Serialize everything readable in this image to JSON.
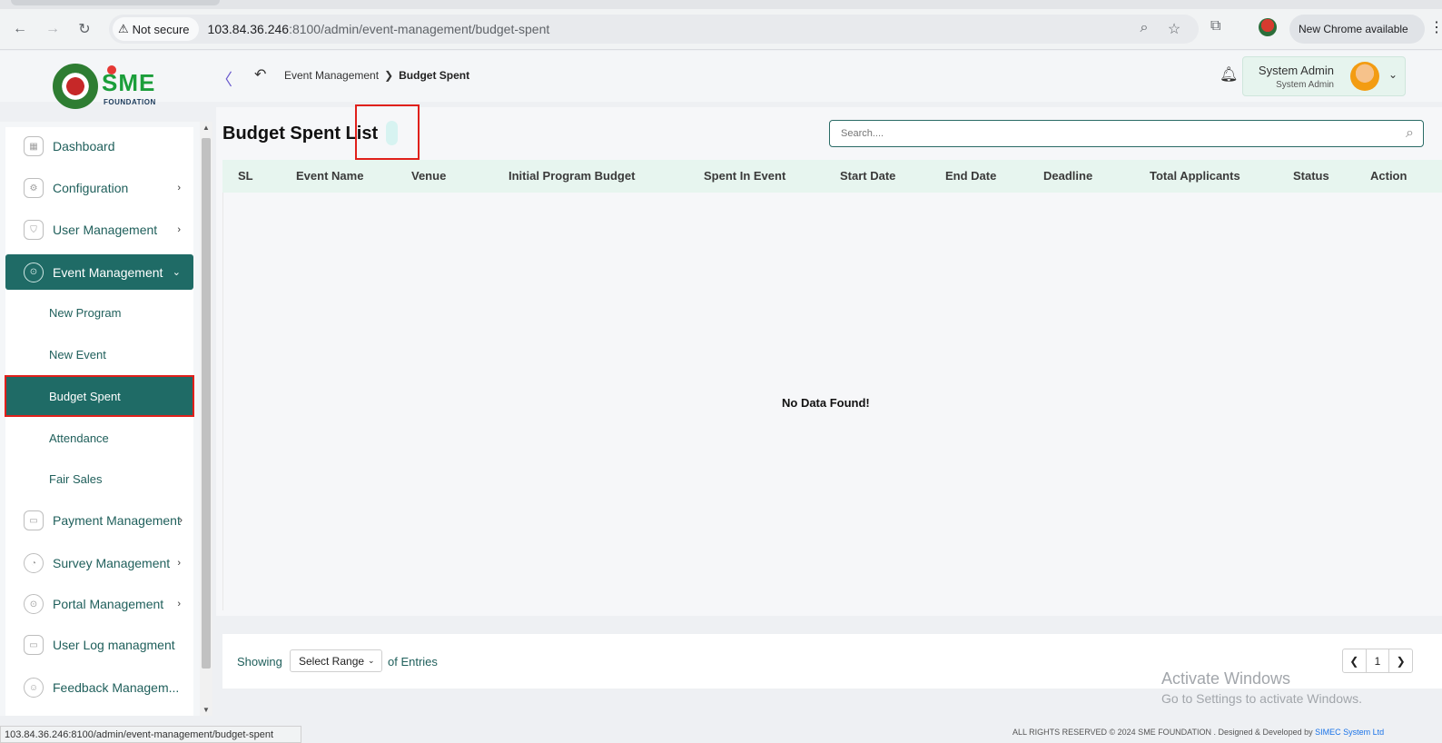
{
  "browser": {
    "security_label": "Not secure",
    "url_host": "103.84.36.246",
    "url_rest": ":8100/admin/event-management/budget-spent",
    "new_chrome_label": "New Chrome available"
  },
  "header": {
    "logo_text": "SME",
    "logo_subtext": "FOUNDATION",
    "breadcrumb_parent": "Event Management",
    "breadcrumb_separator": "❯",
    "breadcrumb_current": "Budget Spent",
    "user_name": "System Admin",
    "user_role": "System Admin"
  },
  "sidebar": {
    "items": [
      {
        "label": "Dashboard",
        "icon": "grid-icon"
      },
      {
        "label": "Configuration",
        "icon": "config-icon"
      },
      {
        "label": "User Management",
        "icon": "shield-user-icon"
      },
      {
        "label": "Event Management",
        "icon": "lock-icon"
      },
      {
        "label": "Payment Management",
        "icon": "money-icon"
      },
      {
        "label": "Survey Management",
        "icon": "pie-icon"
      },
      {
        "label": "Portal Management",
        "icon": "lock-icon"
      },
      {
        "label": "User Log managment",
        "icon": "money-icon"
      },
      {
        "label": "Feedback Managem...",
        "icon": "feedback-icon"
      }
    ],
    "subitems": [
      {
        "label": "New Program"
      },
      {
        "label": "New Event"
      },
      {
        "label": "Budget Spent"
      },
      {
        "label": "Attendance"
      },
      {
        "label": "Fair Sales"
      }
    ]
  },
  "main": {
    "title": "Budget Spent List",
    "search_placeholder": "Search....",
    "columns": [
      "SL",
      "Event Name",
      "Venue",
      "Initial Program Budget",
      "Spent In Event",
      "Start Date",
      "End Date",
      "Deadline",
      "Total Applicants",
      "Status",
      "Action"
    ],
    "empty_text": "No Data Found!",
    "showing_label": "Showing",
    "range_select_label": "Select Range",
    "entries_label": "of Entries",
    "current_page": "1"
  },
  "overlay": {
    "activate_title": "Activate Windows",
    "activate_sub": "Go to Settings to activate Windows.",
    "status_url": "103.84.36.246:8100/admin/event-management/budget-spent",
    "copyright_text": "ALL RIGHTS RESERVED © 2024 SME FOUNDATION . Designed & Developed by",
    "copyright_link": "SIMEC System Ltd"
  },
  "colors": {
    "primary": "#1f6b66",
    "table_header": "#e7f5ef",
    "highlight_box": "#e0201b"
  }
}
